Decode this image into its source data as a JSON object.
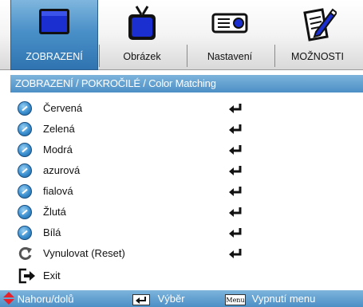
{
  "tabs": [
    {
      "label": "ZOBRAZENÍ",
      "icon": "display-icon",
      "active": true
    },
    {
      "label": "Obrázek",
      "icon": "tv-icon",
      "active": false
    },
    {
      "label": "Nastavení",
      "icon": "projector-icon",
      "active": false
    },
    {
      "label": "MOŽNOSTI",
      "icon": "notepad-pen-icon",
      "active": false
    }
  ],
  "breadcrumb": "ZOBRAZENÍ / POKROČILÉ / Color Matching",
  "items": [
    {
      "label": "Červená",
      "icon": "bullet-icon",
      "action": "enter"
    },
    {
      "label": "Zelená",
      "icon": "bullet-icon",
      "action": "enter"
    },
    {
      "label": "Modrá",
      "icon": "bullet-icon",
      "action": "enter"
    },
    {
      "label": "azurová",
      "icon": "bullet-icon",
      "action": "enter"
    },
    {
      "label": "fialová",
      "icon": "bullet-icon",
      "action": "enter"
    },
    {
      "label": "Žlutá",
      "icon": "bullet-icon",
      "action": "enter"
    },
    {
      "label": "Bílá",
      "icon": "bullet-icon",
      "action": "enter"
    },
    {
      "label": "Vynulovat (Reset)",
      "icon": "reset-icon",
      "action": "enter"
    },
    {
      "label": "Exit",
      "icon": "exit-icon",
      "action": ""
    }
  ],
  "footer": {
    "nav_label": "Nahoru/dolů",
    "select_label": "Výběr",
    "menu_key": "Menu",
    "menu_label": "Vypnutí menu"
  },
  "colors": {
    "accent": "#4a90c8",
    "text": "#111111"
  }
}
